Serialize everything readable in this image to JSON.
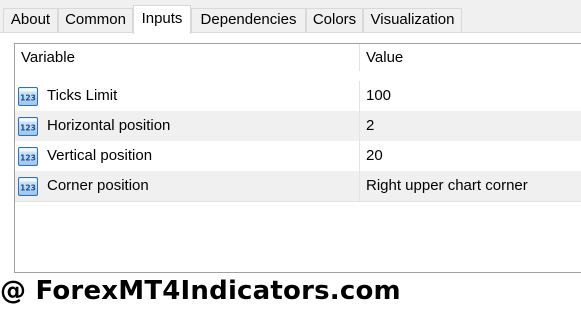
{
  "tabs": [
    {
      "label": "About",
      "active": false
    },
    {
      "label": "Common",
      "active": false
    },
    {
      "label": "Inputs",
      "active": true
    },
    {
      "label": "Dependencies",
      "active": false
    },
    {
      "label": "Colors",
      "active": false
    },
    {
      "label": "Visualization",
      "active": false
    }
  ],
  "table": {
    "columns": [
      "Variable",
      "Value"
    ],
    "rows": [
      {
        "icon": "number-123-icon",
        "variable": "Ticks Limit",
        "value": "100"
      },
      {
        "icon": "number-123-icon",
        "variable": "Horizontal position",
        "value": "2"
      },
      {
        "icon": "number-123-icon",
        "variable": "Vertical position",
        "value": "20"
      },
      {
        "icon": "number-123-icon",
        "variable": "Corner position",
        "value": "Right upper chart corner"
      }
    ]
  },
  "watermark": "@ ForexMT4Indicators.com",
  "colors": {
    "tab_bg": "#f0f0f0",
    "active_tab_bg": "#ffffff",
    "alt_row_bg": "#f0f0f0",
    "icon_blue": "#2e6fb5"
  }
}
